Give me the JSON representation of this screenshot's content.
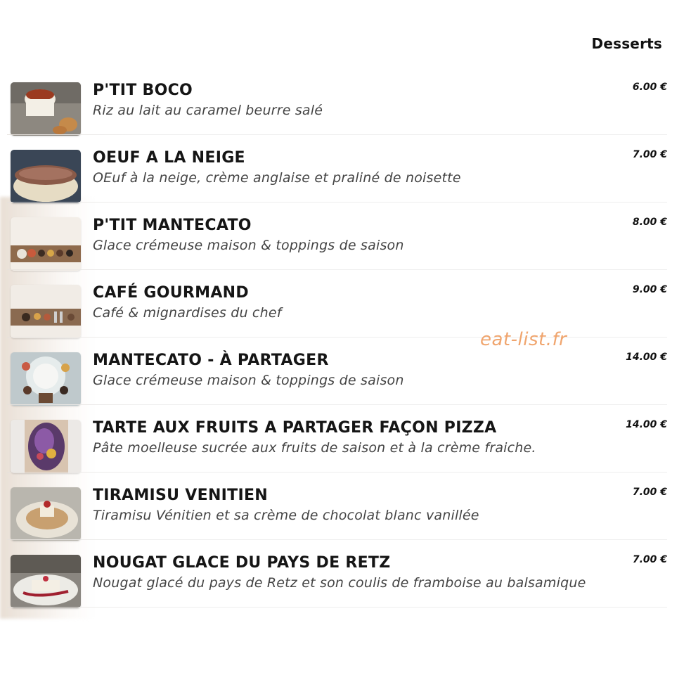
{
  "section": {
    "title": "Desserts"
  },
  "watermark": "eat-list.fr",
  "items": [
    {
      "name": "P'TIT BOCO",
      "description": "Riz au lait au caramel beurre salé",
      "price": "6.00 €"
    },
    {
      "name": "OEUF A LA NEIGE",
      "description": "OEuf à la neige, crème anglaise et praliné de noisette",
      "price": "7.00 €"
    },
    {
      "name": "P'TIT MANTECATO",
      "description": "Glace crémeuse maison & toppings de saison",
      "price": "8.00 €"
    },
    {
      "name": "CAFÉ GOURMAND",
      "description": "Café & mignardises du chef",
      "price": "9.00 €"
    },
    {
      "name": "MANTECATO - À PARTAGER",
      "description": "Glace crémeuse maison & toppings de saison",
      "price": "14.00 €"
    },
    {
      "name": "TARTE AUX FRUITS A PARTAGER FAÇON PIZZA",
      "description": "Pâte moelleuse sucrée aux fruits de saison et à la crème fraiche.",
      "price": "14.00 €"
    },
    {
      "name": "TIRAMISU VENITIEN",
      "description": "Tiramisu Vénitien et sa crème de chocolat blanc vanillée",
      "price": "7.00 €"
    },
    {
      "name": "NOUGAT GLACE DU PAYS DE RETZ",
      "description": "Nougat glacé du pays de Retz et son coulis de framboise au balsamique",
      "price": "7.00 €"
    }
  ]
}
